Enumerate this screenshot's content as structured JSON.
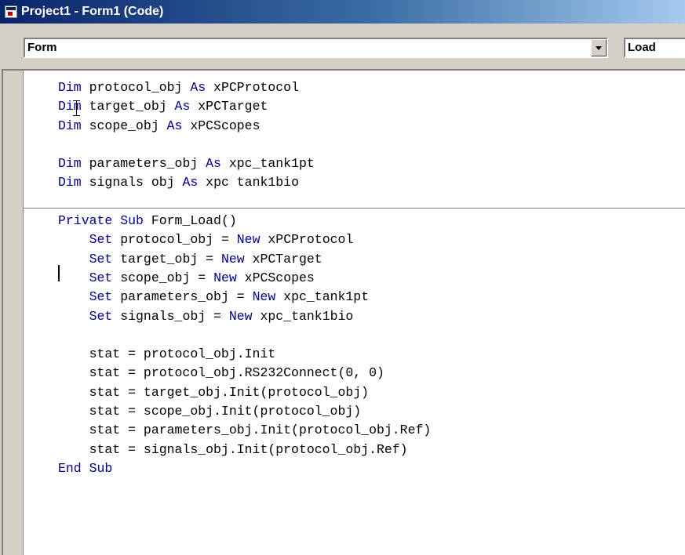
{
  "window": {
    "title": "Project1 - Form1 (Code)"
  },
  "toolbar": {
    "object_combo": {
      "value": "Form"
    },
    "procedure_combo": {
      "value": "Load"
    }
  },
  "code": {
    "colors": {
      "keyword": "#00008b",
      "text": "#000000"
    },
    "lines": [
      [
        {
          "t": "Dim",
          "kw": true
        },
        {
          "t": " protocol_obj "
        },
        {
          "t": "As",
          "kw": true
        },
        {
          "t": " xPCProtocol"
        }
      ],
      [
        {
          "t": "Dim",
          "kw": true
        },
        {
          "t": " target_obj "
        },
        {
          "t": "As",
          "kw": true
        },
        {
          "t": " xPCTarget"
        }
      ],
      [
        {
          "t": "Dim",
          "kw": true
        },
        {
          "t": " scope_obj "
        },
        {
          "t": "As",
          "kw": true
        },
        {
          "t": " xPCScopes"
        }
      ],
      [
        {
          "t": ""
        }
      ],
      [
        {
          "t": "Dim",
          "kw": true
        },
        {
          "t": " parameters_obj "
        },
        {
          "t": "As",
          "kw": true
        },
        {
          "t": " xpc_tank1pt"
        }
      ],
      [
        {
          "t": "Dim",
          "kw": true
        },
        {
          "t": " signals obj "
        },
        {
          "t": "As",
          "kw": true
        },
        {
          "t": " xpc tank1bio"
        }
      ],
      [
        {
          "t": ""
        }
      ],
      [
        {
          "t": "Private",
          "kw": true
        },
        {
          "t": " "
        },
        {
          "t": "Sub",
          "kw": true
        },
        {
          "t": " Form_Load()"
        }
      ],
      [
        {
          "t": "    "
        },
        {
          "t": "Set",
          "kw": true
        },
        {
          "t": " protocol_obj = "
        },
        {
          "t": "New",
          "kw": true
        },
        {
          "t": " xPCProtocol"
        }
      ],
      [
        {
          "t": "    "
        },
        {
          "t": "Set",
          "kw": true
        },
        {
          "t": " target_obj = "
        },
        {
          "t": "New",
          "kw": true
        },
        {
          "t": " xPCTarget"
        }
      ],
      [
        {
          "t": "    "
        },
        {
          "t": "Set",
          "kw": true
        },
        {
          "t": " scope_obj = "
        },
        {
          "t": "New",
          "kw": true
        },
        {
          "t": " xPCScopes"
        }
      ],
      [
        {
          "t": "    "
        },
        {
          "t": "Set",
          "kw": true
        },
        {
          "t": " parameters_obj = "
        },
        {
          "t": "New",
          "kw": true
        },
        {
          "t": " xpc_tank1pt"
        }
      ],
      [
        {
          "t": "    "
        },
        {
          "t": "Set",
          "kw": true
        },
        {
          "t": " signals_obj = "
        },
        {
          "t": "New",
          "kw": true
        },
        {
          "t": " xpc_tank1bio"
        }
      ],
      [
        {
          "t": ""
        }
      ],
      [
        {
          "t": "    stat = protocol_obj.Init"
        }
      ],
      [
        {
          "t": "    stat = protocol_obj.RS232Connect(0, 0)"
        }
      ],
      [
        {
          "t": "    stat = target_obj.Init(protocol_obj)"
        }
      ],
      [
        {
          "t": "    stat = scope_obj.Init(protocol_obj)"
        }
      ],
      [
        {
          "t": "    stat = parameters_obj.Init(protocol_obj.Ref)"
        }
      ],
      [
        {
          "t": "    stat = signals_obj.Init(protocol_obj.Ref)"
        }
      ],
      [
        {
          "t": "End",
          "kw": true
        },
        {
          "t": " "
        },
        {
          "t": "Sub",
          "kw": true
        }
      ]
    ]
  }
}
